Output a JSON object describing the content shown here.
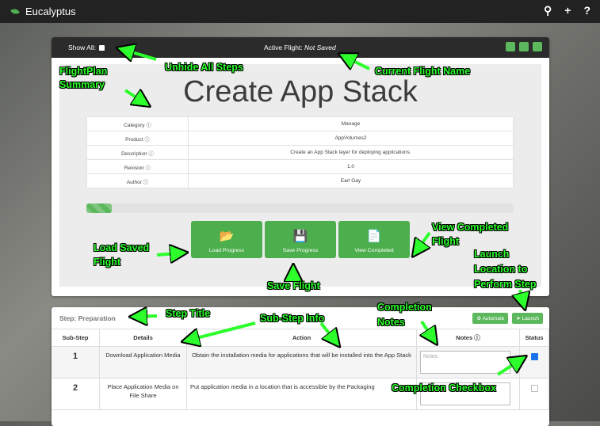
{
  "app": {
    "name": "Eucalyptus",
    "actions": [
      "search-icon",
      "plus-icon",
      "help-icon"
    ]
  },
  "header": {
    "show_all_label": "Show All:",
    "active_flight_label": "Active Flight:",
    "active_flight_value": "Not Saved"
  },
  "summary": {
    "title": "Create App Stack",
    "rows": [
      {
        "label": "Category ⓘ",
        "value": "Manage"
      },
      {
        "label": "Product ⓘ",
        "value": "AppVolumes2"
      },
      {
        "label": "Description ⓘ",
        "value": "Create an App Stack layer for deploying applications."
      },
      {
        "label": "Revision ⓘ",
        "value": "1.0"
      },
      {
        "label": "Author ⓘ",
        "value": "Earl Gay"
      }
    ],
    "progress_fraction": 0.06
  },
  "buttons": {
    "load": "Load Progress",
    "save": "Save Progress",
    "view": "View Completed"
  },
  "step": {
    "title": "Step: Preparation",
    "automate": "⚙ Automate",
    "launch": "➤ Launch",
    "columns": [
      "Sub-Step",
      "Details",
      "Action",
      "Notes ⓘ",
      "Status"
    ],
    "rows": [
      {
        "num": "1",
        "details": "Download Application Media",
        "action": "Obtain the installation media for applications that will be installed into the App Stack",
        "notes_placeholder": "Notes",
        "done": true
      },
      {
        "num": "2",
        "details": "Place Application Media on File Share",
        "action": "Put application media in a location that is accessible by the Packaging",
        "notes_placeholder": "",
        "done": false
      }
    ]
  },
  "annotations": {
    "unhide": "Unhide All Steps",
    "flight_name": "Current Flight Name",
    "summary1": "FlightPlan",
    "summary2": "Summary",
    "load1": "Load Saved",
    "load2": "Flight",
    "save": "Save Flight",
    "view1": "View Completed",
    "view2": "Flight",
    "launch1": "Launch",
    "launch2": "Location to",
    "launch3": "Perform Step",
    "step_title": "Step Title",
    "substep": "Sub-Step Info",
    "notes1": "Completion",
    "notes2": "Notes",
    "checkbox": "Completion Checkbox"
  },
  "colors": {
    "accent": "#5cb85c",
    "annotation": "#2cff2c",
    "topbar": "#222222"
  }
}
